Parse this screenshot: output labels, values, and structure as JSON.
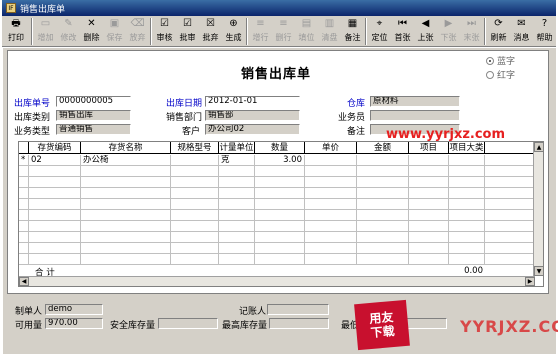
{
  "window": {
    "title": "销售出库单",
    "app_icon": "IF"
  },
  "toolbar": {
    "buttons": [
      {
        "name": "print-button",
        "label": "打印",
        "icon": "🖶",
        "enabled": true,
        "wide": true
      },
      {
        "name": "add-button",
        "label": "增加",
        "icon": "▭",
        "enabled": false
      },
      {
        "name": "modify-button",
        "label": "修改",
        "icon": "✎",
        "enabled": false
      },
      {
        "name": "delete-button",
        "label": "删除",
        "icon": "✕",
        "enabled": true
      },
      {
        "name": "save-button",
        "label": "保存",
        "icon": "▣",
        "enabled": false
      },
      {
        "name": "abandon-button",
        "label": "放弃",
        "icon": "⌫",
        "enabled": false
      },
      {
        "name": "audit-button",
        "label": "审核",
        "icon": "☑",
        "enabled": true
      },
      {
        "name": "approve-button",
        "label": "批审",
        "icon": "☑",
        "enabled": true
      },
      {
        "name": "batch-abandon-button",
        "label": "批弃",
        "icon": "☒",
        "enabled": true
      },
      {
        "name": "generate-button",
        "label": "生成",
        "icon": "⊕",
        "enabled": true
      },
      {
        "name": "add-row-button",
        "label": "增行",
        "icon": "≡",
        "enabled": false
      },
      {
        "name": "delete-row-button",
        "label": "删行",
        "icon": "≡",
        "enabled": false
      },
      {
        "name": "fill-row-button",
        "label": "填位",
        "icon": "▤",
        "enabled": false
      },
      {
        "name": "clear-button",
        "label": "清盘",
        "icon": "▥",
        "enabled": false
      },
      {
        "name": "sign-button",
        "label": "备注",
        "icon": "▦",
        "enabled": true
      },
      {
        "name": "locate-button",
        "label": "定位",
        "icon": "⌖",
        "enabled": true
      },
      {
        "name": "first-button",
        "label": "首张",
        "icon": "⏮",
        "enabled": true
      },
      {
        "name": "prev-button",
        "label": "上张",
        "icon": "◀",
        "enabled": true
      },
      {
        "name": "next-button",
        "label": "下张",
        "icon": "▶",
        "enabled": false
      },
      {
        "name": "last-button",
        "label": "末张",
        "icon": "⏭",
        "enabled": false
      },
      {
        "name": "refresh-button",
        "label": "刷新",
        "icon": "⟳",
        "enabled": true
      },
      {
        "name": "message-button",
        "label": "消息",
        "icon": "✉",
        "enabled": true
      },
      {
        "name": "help-button",
        "label": "帮助",
        "icon": "?",
        "enabled": true
      }
    ]
  },
  "doc": {
    "title": "销售出库单",
    "radio_blue": "蓝字",
    "radio_red": "红字",
    "fields": {
      "out_no_label": "出库单号",
      "out_no": "0000000005",
      "out_date_label": "出库日期",
      "out_date": "2012-01-01",
      "warehouse_label": "仓库",
      "warehouse": "原材料",
      "out_type_label": "出库类别",
      "out_type": "销售出库",
      "dept_label": "销售部门",
      "dept": "销售部",
      "salesman_label": "业务员",
      "salesman": "",
      "biz_type_label": "业务类型",
      "biz_type": "普通销售",
      "customer_label": "客户",
      "customer": "办公司02",
      "remark_label": "备注",
      "remark": ""
    }
  },
  "grid": {
    "headers": [
      "",
      "存货编码",
      "存货名称",
      "规格型号",
      "计量单位",
      "数量",
      "单价",
      "金额",
      "项目",
      "项目大类"
    ],
    "rows": [
      [
        "*",
        "02",
        "办公椅",
        "",
        "克",
        "3.00",
        "",
        "",
        "",
        ""
      ]
    ],
    "total_label": "合  计",
    "total_amount": "0.00"
  },
  "footer": {
    "maker_label": "制单人",
    "maker": "demo",
    "bookkeeper_label": "记账人",
    "bookkeeper": "",
    "available_label": "可用量",
    "available": "970.00",
    "safety_label": "安全库存量",
    "safety": "",
    "max_label": "最高库存量",
    "max": "",
    "min_label": "最低库存量",
    "min": ""
  },
  "watermark": {
    "site": "www.yyrjxz.com",
    "logo_line1": "用友",
    "logo_line2": "下载",
    "site2": "YYRJXZ.COM"
  }
}
